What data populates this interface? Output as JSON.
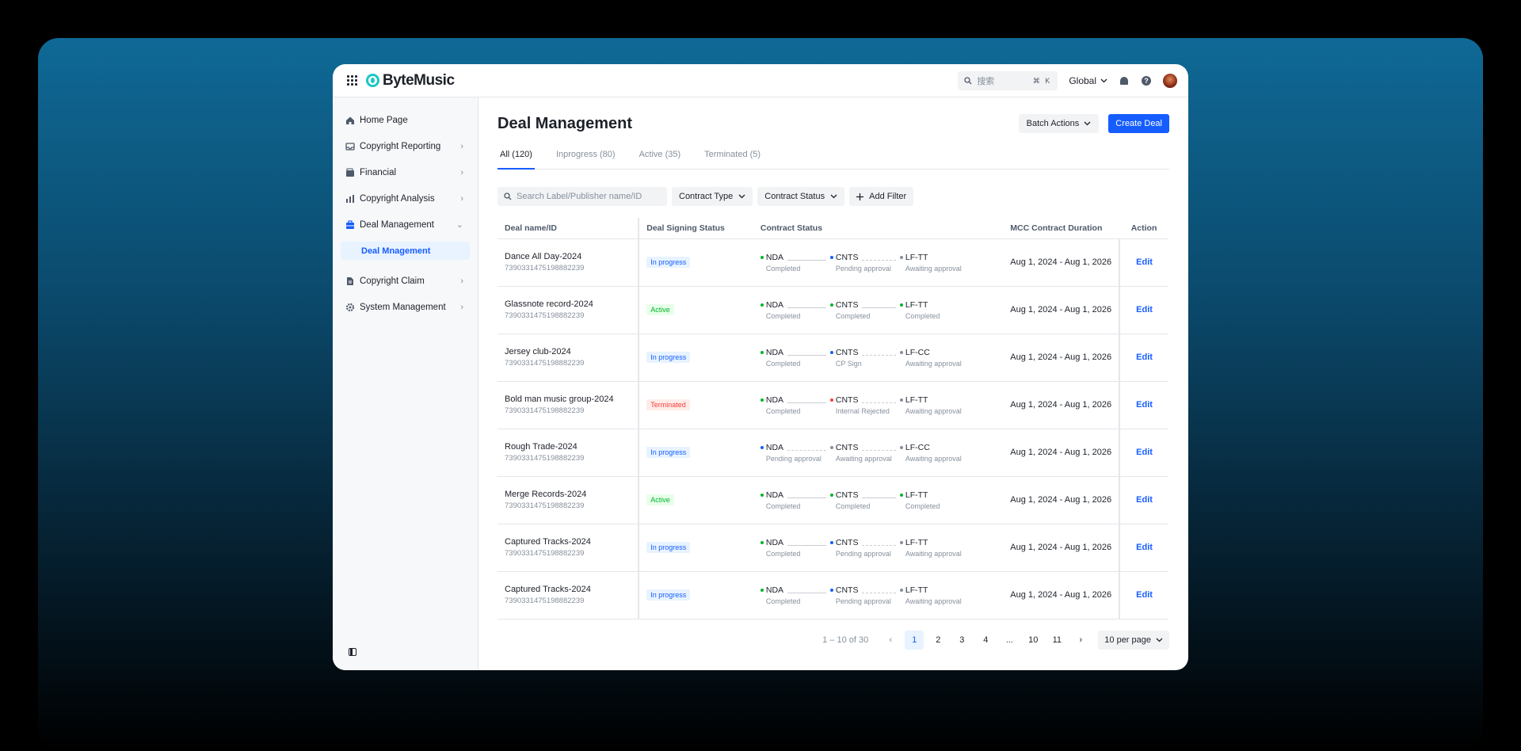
{
  "app": {
    "name": "ByteMusic"
  },
  "topbar": {
    "search_placeholder": "搜索",
    "shortcut": "⌘ K",
    "region": "Global"
  },
  "sidebar": {
    "items": [
      {
        "label": "Home Page"
      },
      {
        "label": "Copyright Reporting"
      },
      {
        "label": "Financial"
      },
      {
        "label": "Copyright Analysis"
      },
      {
        "label": "Deal Management"
      },
      {
        "label": "Copyright Claim"
      },
      {
        "label": "System Management"
      }
    ],
    "sub_active": "Deal Mnagement"
  },
  "page": {
    "title": "Deal Management",
    "batch_actions": "Batch Actions",
    "create_deal": "Create Deal"
  },
  "tabs": [
    "All (120)",
    "Inprogress (80)",
    "Active (35)",
    "Terminated (5)"
  ],
  "filters": {
    "search_placeholder": "Search Label/Publisher name/ID",
    "contract_type": "Contract Type",
    "contract_status": "Contract Status",
    "add_filter": "Add Filter"
  },
  "table": {
    "headers": [
      "Deal name/ID",
      "Deal Signing Status",
      "Contract Status",
      "MCC Contract Duration",
      "Action"
    ],
    "rows": [
      {
        "name": "Dance All Day-2024",
        "id": "7390331475198882239",
        "status": "In progress",
        "s1": "NDA",
        "s1sub": "Completed",
        "s2": "CNTS",
        "s2sub": "Pending approval",
        "s3": "LF-TT",
        "s3sub": "Awaiting approval",
        "duration": "Aug 1, 2024 - Aug 1, 2026",
        "action": "Edit"
      },
      {
        "name": "Glassnote record-2024",
        "id": "7390331475198882239",
        "status": "Active",
        "s1": "NDA",
        "s1sub": "Completed",
        "s2": "CNTS",
        "s2sub": "Completed",
        "s3": "LF-TT",
        "s3sub": "Completed",
        "duration": "Aug 1, 2024 - Aug 1, 2026",
        "action": "Edit"
      },
      {
        "name": "Jersey club-2024",
        "id": "7390331475198882239",
        "status": "In progress",
        "s1": "NDA",
        "s1sub": "Completed",
        "s2": "CNTS",
        "s2sub": "CP Sign",
        "s3": "LF-CC",
        "s3sub": "Awaiting approval",
        "duration": "Aug 1, 2024 - Aug 1, 2026",
        "action": "Edit"
      },
      {
        "name": "Bold man music group-2024",
        "id": "7390331475198882239",
        "status": "Terminated",
        "s1": "NDA",
        "s1sub": "Completed",
        "s2": "CNTS",
        "s2sub": "Internal Rejected",
        "s3": "LF-TT",
        "s3sub": "Awaiting approval",
        "duration": "Aug 1, 2024 - Aug 1, 2026",
        "action": "Edit"
      },
      {
        "name": "Rough Trade-2024",
        "id": "7390331475198882239",
        "status": "In progress",
        "s1": "NDA",
        "s1sub": "Pending approval",
        "s2": "CNTS",
        "s2sub": "Awaiting approval",
        "s3": "LF-CC",
        "s3sub": "Awaiting approval",
        "duration": "Aug 1, 2024 - Aug 1, 2026",
        "action": "Edit"
      },
      {
        "name": "Merge Records-2024",
        "id": "7390331475198882239",
        "status": "Active",
        "s1": "NDA",
        "s1sub": "Completed",
        "s2": "CNTS",
        "s2sub": "Completed",
        "s3": "LF-TT",
        "s3sub": "Completed",
        "duration": "Aug 1, 2024 - Aug 1, 2026",
        "action": "Edit"
      },
      {
        "name": "Captured Tracks-2024",
        "id": "7390331475198882239",
        "status": "In progress",
        "s1": "NDA",
        "s1sub": "Completed",
        "s2": "CNTS",
        "s2sub": "Pending approval",
        "s3": "LF-TT",
        "s3sub": "Awaiting approval",
        "duration": "Aug 1, 2024 - Aug 1, 2026",
        "action": "Edit"
      },
      {
        "name": "Captured Tracks-2024",
        "id": "7390331475198882239",
        "status": "In progress",
        "s1": "NDA",
        "s1sub": "Completed",
        "s2": "CNTS",
        "s2sub": "Pending approval",
        "s3": "LF-TT",
        "s3sub": "Awaiting approval",
        "duration": "Aug 1, 2024 - Aug 1, 2026",
        "action": "Edit"
      }
    ]
  },
  "pagination": {
    "range": "1 – 10 of 30",
    "pages": [
      "1",
      "2",
      "3",
      "4",
      "...",
      "10",
      "11"
    ],
    "current": "1",
    "per_page": "10 per page"
  },
  "colors": {
    "primary": "#165dff",
    "success": "#00b42a",
    "danger": "#f53f3f",
    "brand_teal": "#1ec6c6"
  }
}
